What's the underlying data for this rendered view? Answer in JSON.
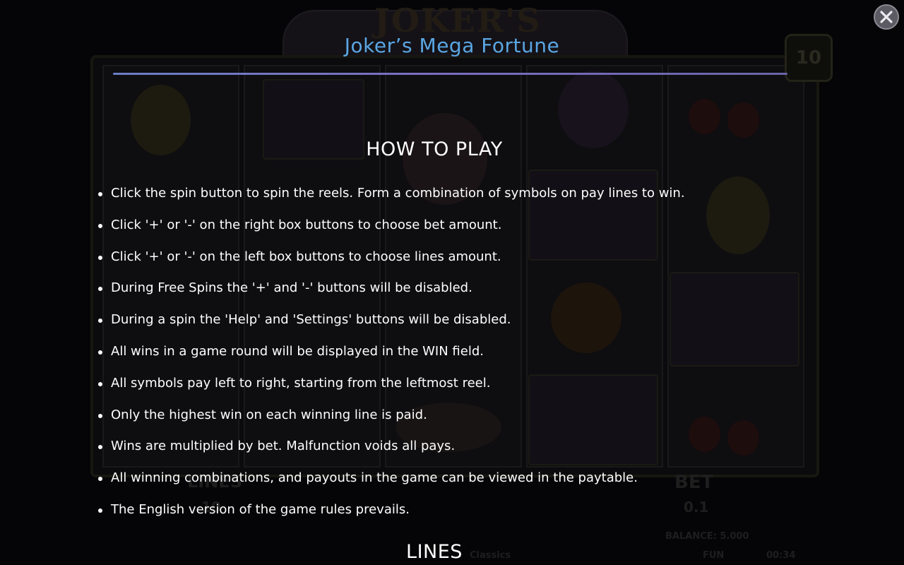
{
  "background": {
    "logo_text": "JOKER'S",
    "lines_value": "10",
    "lines_label": "LINES",
    "lines_count": "10",
    "bet_label": "BET",
    "bet_value": "0.1",
    "balance": "BALANCE: 5.000",
    "mode": "FUN",
    "clock": "00:34",
    "footer_brand": "Classics"
  },
  "help": {
    "title": "Joker’s Mega Fortune",
    "close_icon": "close-x-icon",
    "how_to_play": {
      "heading": "HOW TO PLAY",
      "rules": [
        "Click the spin button to spin the reels. Form a combination of symbols on pay lines to win.",
        "Click '+' or '-' on the right box buttons to choose bet amount.",
        "Click '+' or '-' on the left box buttons to choose lines amount.",
        "During Free Spins the '+' and '-' buttons will be disabled.",
        "During a spin the 'Help' and 'Settings' buttons will be disabled.",
        "All wins in a game round will be displayed in the WIN field.",
        "All symbols pay left to right, starting from the leftmost reel.",
        "Only the highest win on each winning line is paid.",
        "Wins are multiplied by bet. Malfunction voids all pays.",
        "All winning combinations, and payouts in the game can be viewed in the paytable.",
        "The English version of the game rules prevails."
      ]
    },
    "lines": {
      "heading": "LINES"
    }
  },
  "colors": {
    "title": "#5aa6e3",
    "text": "#ffffff",
    "rule": "#7a6fc0",
    "backdrop": "#050507"
  }
}
